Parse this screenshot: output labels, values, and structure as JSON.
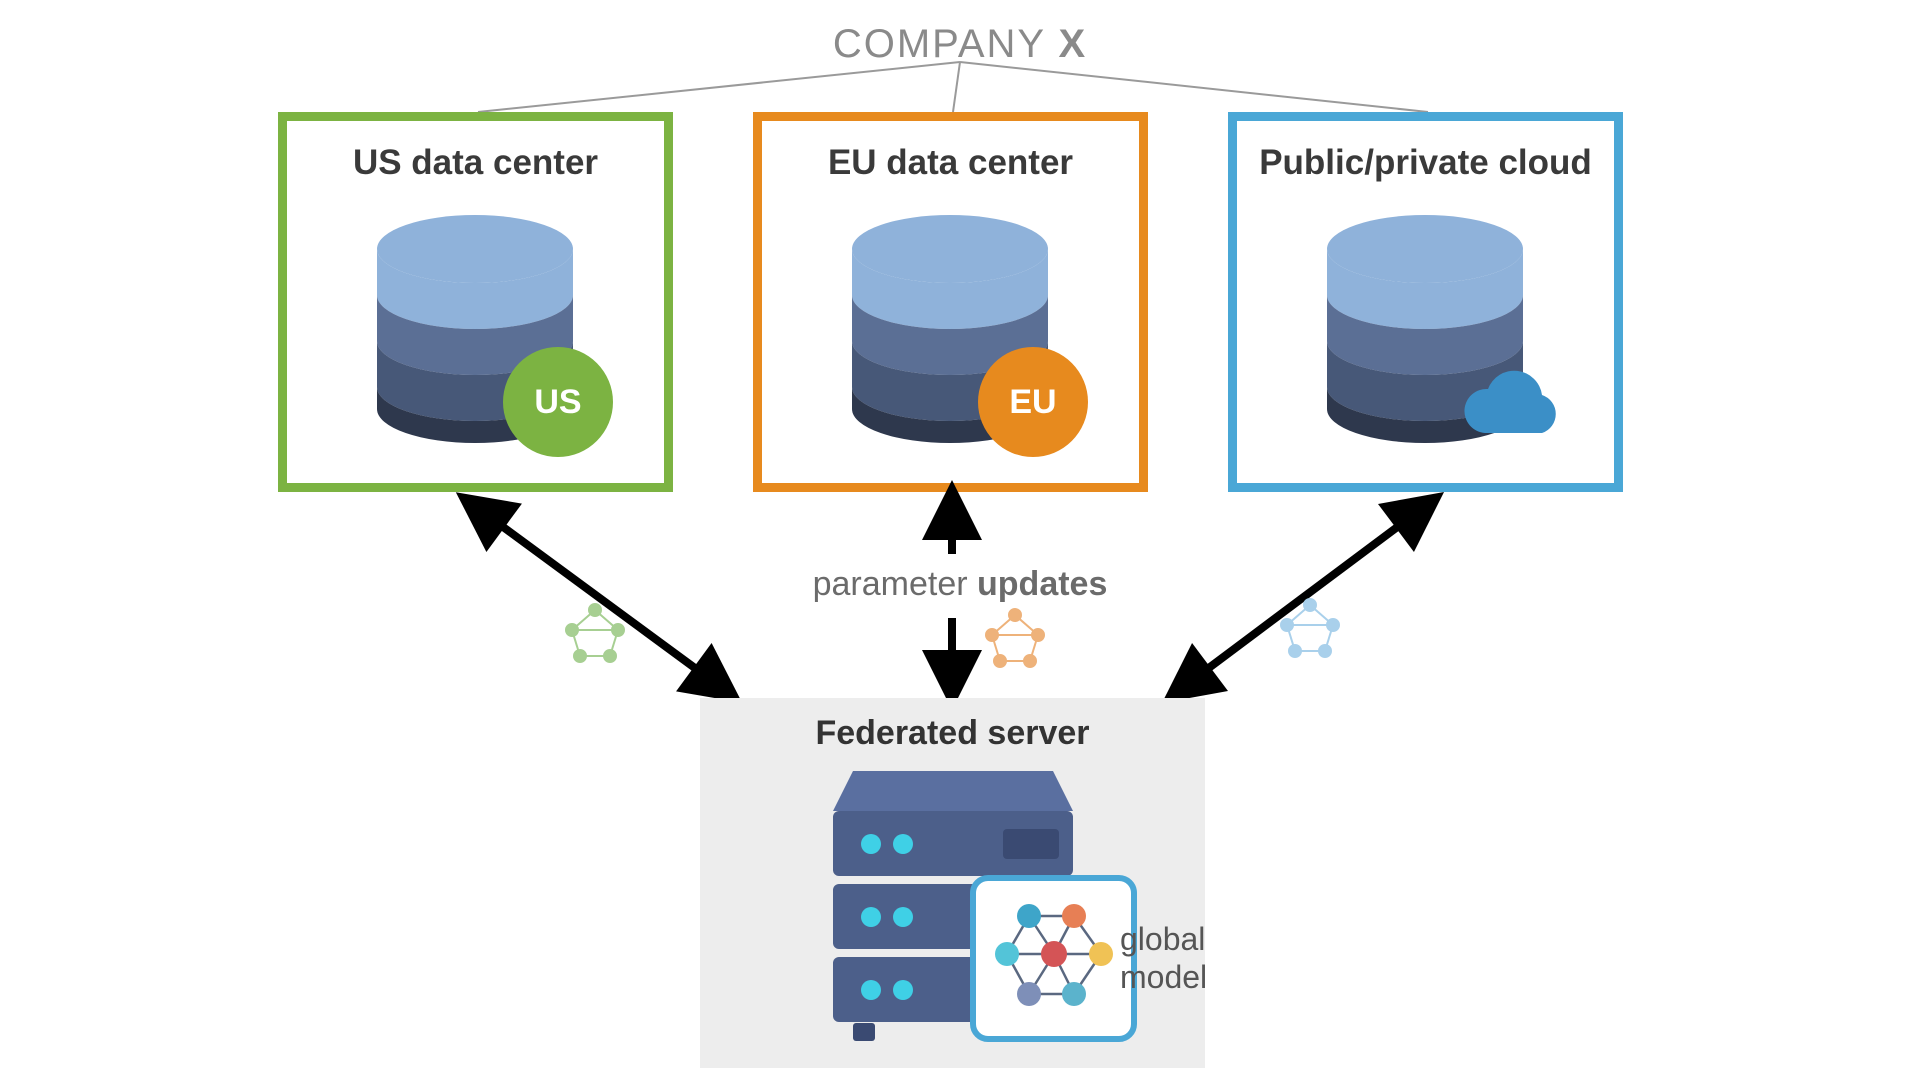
{
  "header": {
    "company_prefix": "COMPANY ",
    "company_x": "X"
  },
  "datacenters": {
    "us": {
      "title": "US data center",
      "badge": "US"
    },
    "eu": {
      "title": "EU data center",
      "badge": "EU"
    },
    "cloud": {
      "title": "Public/private cloud"
    }
  },
  "labels": {
    "param_prefix": "parameter ",
    "param_bold": "updates"
  },
  "federated": {
    "title": "Federated server",
    "global_model_line1": "global",
    "global_model_line2": "model"
  },
  "colors": {
    "us": "#7cb342",
    "eu": "#e78a1e",
    "cloud": "#4aa7d6",
    "db_top": "#8fb2da",
    "db_mid": "#5b6f95",
    "db_mid2": "#475878",
    "db_dark": "#2e384d",
    "server": "#4c5f8a",
    "server_dark": "#3a4a72",
    "led": "#3fd0e6"
  }
}
